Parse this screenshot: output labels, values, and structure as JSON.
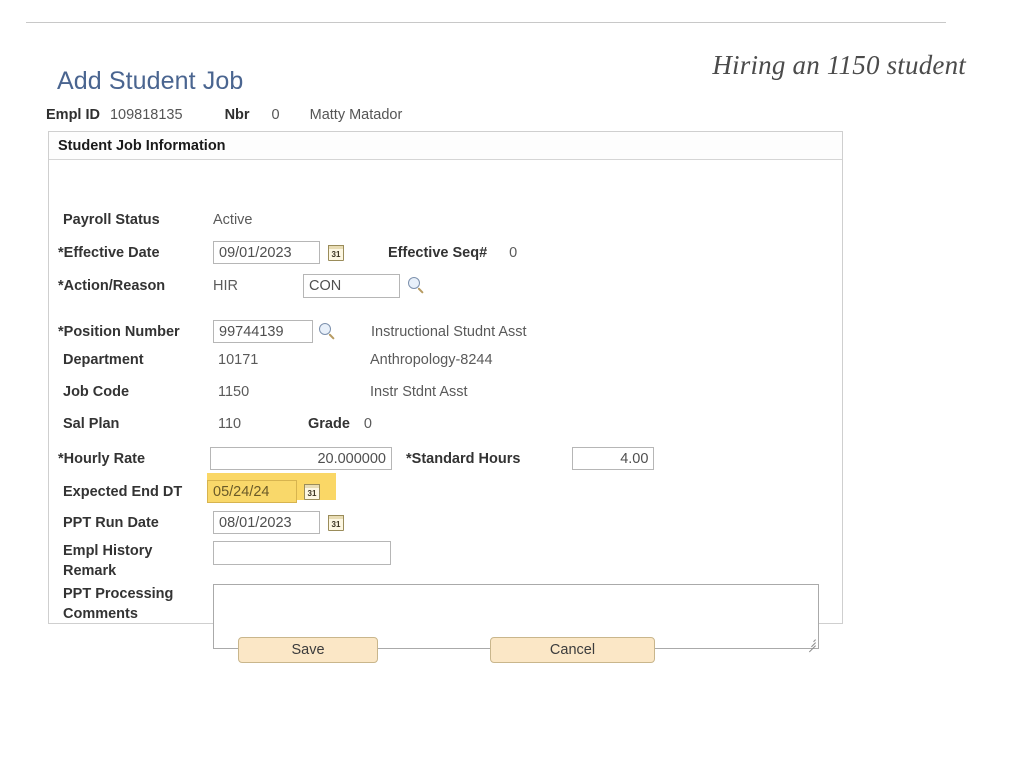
{
  "slide": {
    "headline": "Hiring an 1150 student"
  },
  "page": {
    "title": "Add Student Job"
  },
  "empl_bar": {
    "empl_id_label": "Empl ID",
    "empl_id_value": "109818135",
    "nbr_label": "Nbr",
    "nbr_value": "0",
    "employee_name": "Matty Matador"
  },
  "panel": {
    "header": "Student Job Information",
    "fields": {
      "payroll_status": {
        "label": "Payroll Status",
        "value": "Active"
      },
      "effective_date": {
        "label": "*Effective Date",
        "value": "09/01/2023",
        "calendar_icon": "31"
      },
      "effective_seq": {
        "label": "Effective Seq#",
        "value": "0"
      },
      "action_reason": {
        "label": "*Action/Reason",
        "action": "HIR",
        "reason": "CON"
      },
      "position_number": {
        "label": "*Position Number",
        "value": "99744139",
        "description": "Instructional Studnt Asst"
      },
      "department": {
        "label": "Department",
        "value": "10171",
        "description": "Anthropology-8244"
      },
      "job_code": {
        "label": "Job Code",
        "value": "1150",
        "description": "Instr Stdnt Asst"
      },
      "sal_plan": {
        "label": "Sal Plan",
        "value": "110"
      },
      "grade": {
        "label": "Grade",
        "value": "0"
      },
      "hourly_rate": {
        "label": "*Hourly Rate",
        "value": "20.000000"
      },
      "standard_hours": {
        "label": "*Standard Hours",
        "value": "4.00"
      },
      "expected_end_dt": {
        "label": "Expected End DT",
        "value": "05/24/24",
        "calendar_icon": "31",
        "highlight_color": "#fad766"
      },
      "ppt_run_date": {
        "label": "PPT Run Date",
        "value": "08/01/2023",
        "calendar_icon": "31"
      },
      "empl_history_remark": {
        "label": "Empl History Remark",
        "label_line1": "Empl History",
        "label_line2": "Remark",
        "value": ""
      },
      "ppt_processing_comments": {
        "label": "PPT Processing Comments",
        "label_line1": "PPT Processing",
        "label_line2": "Comments",
        "value": ""
      }
    }
  },
  "actions": {
    "save_label": "Save",
    "cancel_label": "Cancel"
  }
}
